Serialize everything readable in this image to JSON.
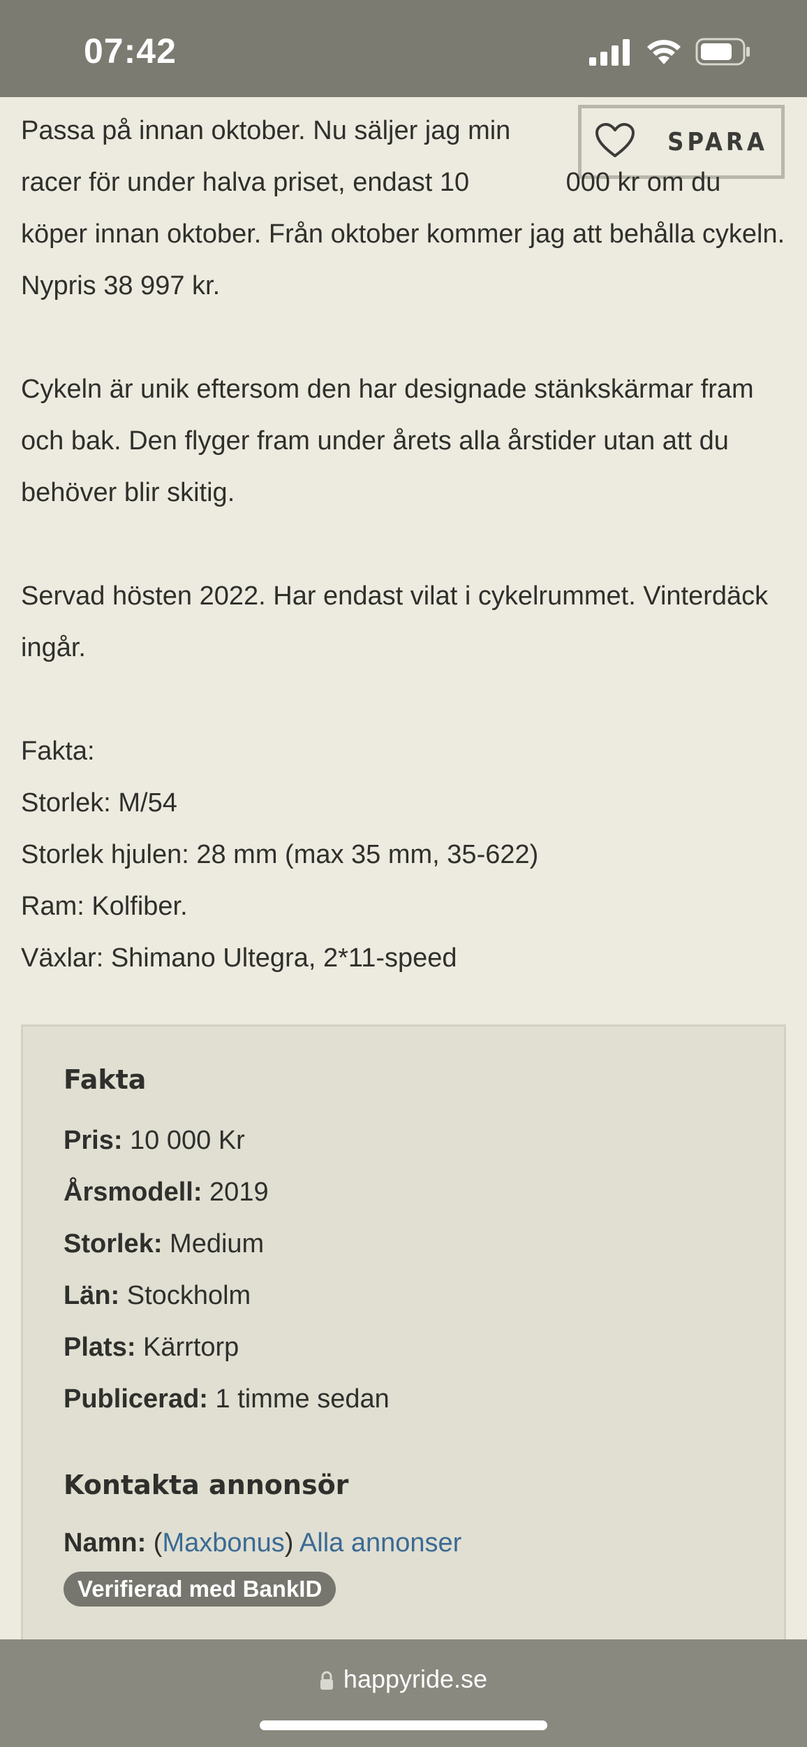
{
  "status_bar": {
    "time": "07:42",
    "icons": [
      "cellular-signal-icon",
      "wifi-icon",
      "battery-icon"
    ]
  },
  "save_button": {
    "label": "SPARA",
    "icon": "heart-icon"
  },
  "description": {
    "paragraph1_lead": "Passa på innan oktober. Nu säljer jag min racer för under halva priset, endast 10",
    "paragraph1_rest": "000 kr om du köper innan oktober. Från oktober kommer jag att behålla cykeln. Nypris 38 997 kr.",
    "paragraph2": "Cykeln är unik eftersom den har designade stänkskärmar fram och bak. Den flyger fram under årets alla årstider utan att du behöver blir skitig.",
    "paragraph3": "Servad hösten 2022. Har endast vilat i cykelrummet. Vinterdäck ingår.",
    "facts_heading": "Fakta:",
    "facts_lines": [
      "Storlek: M/54",
      "Storlek hjulen: 28 mm (max 35 mm, 35-622)",
      "Ram: Kolfiber.",
      "Växlar: Shimano Ultegra, 2*11-speed"
    ]
  },
  "facts_box": {
    "title": "Fakta",
    "rows": [
      {
        "label": "Pris:",
        "value": "10 000 Kr"
      },
      {
        "label": "Årsmodell:",
        "value": "2019"
      },
      {
        "label": "Storlek:",
        "value": "Medium"
      },
      {
        "label": "Län:",
        "value": "Stockholm"
      },
      {
        "label": "Plats:",
        "value": "Kärrtorp"
      },
      {
        "label": "Publicerad:",
        "value": "1 timme sedan"
      }
    ],
    "contact_title": "Kontakta annonsör",
    "name_label": "Namn:",
    "name_open": "(",
    "name_link": "Maxbonus",
    "name_close": ")",
    "all_ads_link": "Alla annonser",
    "verified_badge": "Verifierad med BankID"
  },
  "url_bar": {
    "domain": "happyride.se",
    "icon": "lock-icon"
  },
  "colors": {
    "background": "#edebdf",
    "status_bar": "#7c7b71",
    "facts_box": "#e0dfd2",
    "link": "#3b6a94",
    "badge": "#76766e",
    "url_bar": "#8a897f"
  }
}
